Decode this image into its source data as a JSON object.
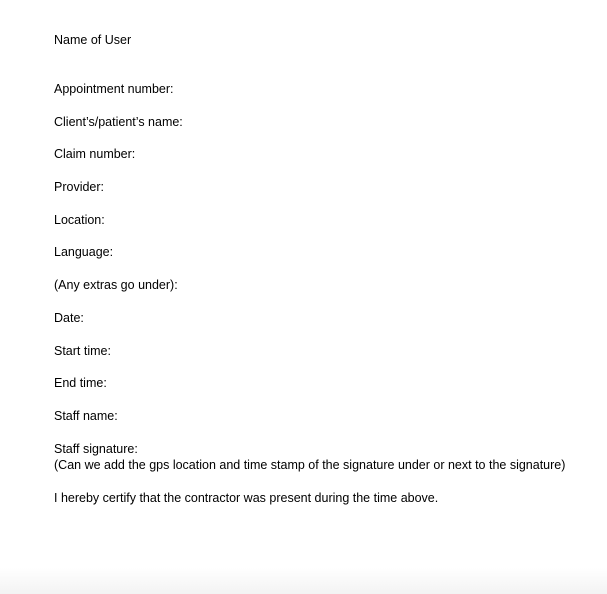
{
  "document": {
    "header": "Name of User",
    "fields": [
      "Appointment number:",
      "Client’s/patient’s name:",
      "Claim number:",
      "Provider:",
      "Location:",
      "Language:",
      "(Any extras go under):",
      "Date:",
      "Start time:",
      "End time:",
      "Staff name:",
      "Staff signature:"
    ],
    "signature_note": "(Can we add the gps location and time stamp of the signature under or next to the signature)",
    "certification": "I hereby certify that the contractor was present during the time above."
  }
}
